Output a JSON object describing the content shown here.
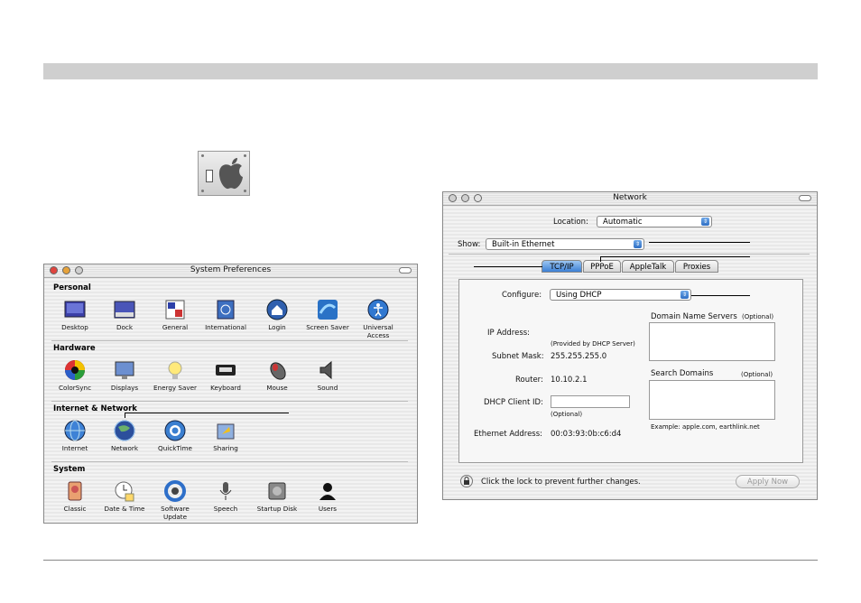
{
  "sysprefs": {
    "title": "System Preferences",
    "sections": [
      {
        "title": "Personal",
        "items": [
          "Desktop",
          "Dock",
          "General",
          "International",
          "Login",
          "Screen Saver",
          "Universal\nAccess"
        ]
      },
      {
        "title": "Hardware",
        "items": [
          "ColorSync",
          "Displays",
          "Energy Saver",
          "Keyboard",
          "Mouse",
          "Sound"
        ]
      },
      {
        "title": "Internet & Network",
        "items": [
          "Internet",
          "Network",
          "QuickTime",
          "Sharing"
        ]
      },
      {
        "title": "System",
        "items": [
          "Classic",
          "Date & Time",
          "Software\nUpdate",
          "Speech",
          "Startup Disk",
          "Users"
        ]
      }
    ]
  },
  "network": {
    "title": "Network",
    "location_label": "Location:",
    "location_value": "Automatic",
    "show_label": "Show:",
    "show_value": "Built-in Ethernet",
    "tabs": [
      "TCP/IP",
      "PPPoE",
      "AppleTalk",
      "Proxies"
    ],
    "configure_label": "Configure:",
    "configure_value": "Using DHCP",
    "ip_label": "IP Address:",
    "ip_note": "(Provided by DHCP Server)",
    "subnet_label": "Subnet Mask:",
    "subnet_value": "255.255.255.0",
    "router_label": "Router:",
    "router_value": "10.10.2.1",
    "dhcp_label": "DHCP Client ID:",
    "dhcp_note": "(Optional)",
    "ether_label": "Ethernet Address:",
    "ether_value": "00:03:93:0b:c6:d4",
    "dns_label": "Domain Name Servers",
    "dns_opt": "(Optional)",
    "search_label": "Search Domains",
    "search_opt": "(Optional)",
    "example": "Example: apple.com, earthlink.net",
    "lock_text": "Click the lock to prevent further changes.",
    "apply_label": "Apply Now"
  },
  "colors": {
    "accent": "#3c7fd4",
    "close": "#e0443e",
    "min": "#e6a23a",
    "zoom": "#c9c9c9"
  }
}
